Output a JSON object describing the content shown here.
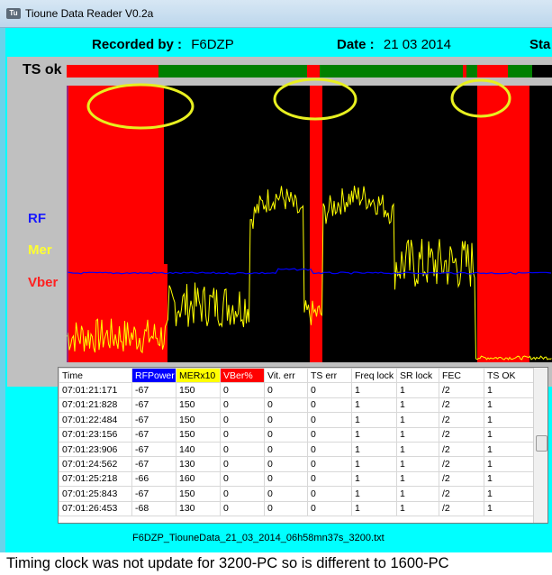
{
  "window": {
    "title": "Tioune Data Reader V0.2a"
  },
  "header": {
    "recorded_label": "Recorded by :",
    "recorded_value": "F6DZP",
    "date_label": "Date :",
    "date_value": "21 03 2014",
    "status_label": "Sta"
  },
  "labels": {
    "tsok": "TS ok",
    "rf": "RF",
    "mer": "Mer",
    "vber": "Vber"
  },
  "colors": {
    "rf": "#0000ff",
    "mer": "#ffff00",
    "vber": "#ff0000",
    "ts_ok": "#008000",
    "background": "#00ffff"
  },
  "table": {
    "headers": [
      "Time",
      "RFPower",
      "MERx10",
      "VBer%",
      "Vit. err",
      "TS err",
      "Freq lock",
      "SR lock",
      "FEC",
      "TS OK"
    ],
    "rows": [
      [
        "07:01:21:171",
        "-67",
        "150",
        "0",
        "0",
        "0",
        "1",
        "1",
        "/2",
        "1"
      ],
      [
        "07:01:21:828",
        "-67",
        "150",
        "0",
        "0",
        "0",
        "1",
        "1",
        "/2",
        "1"
      ],
      [
        "07:01:22:484",
        "-67",
        "150",
        "0",
        "0",
        "0",
        "1",
        "1",
        "/2",
        "1"
      ],
      [
        "07:01:23:156",
        "-67",
        "150",
        "0",
        "0",
        "0",
        "1",
        "1",
        "/2",
        "1"
      ],
      [
        "07:01:23:906",
        "-67",
        "140",
        "0",
        "0",
        "0",
        "1",
        "1",
        "/2",
        "1"
      ],
      [
        "07:01:24:562",
        "-67",
        "130",
        "0",
        "0",
        "0",
        "1",
        "1",
        "/2",
        "1"
      ],
      [
        "07:01:25:218",
        "-66",
        "160",
        "0",
        "0",
        "0",
        "1",
        "1",
        "/2",
        "1"
      ],
      [
        "07:01:25:843",
        "-67",
        "150",
        "0",
        "0",
        "0",
        "1",
        "1",
        "/2",
        "1"
      ],
      [
        "07:01:26:453",
        "-68",
        "130",
        "0",
        "0",
        "0",
        "1",
        "1",
        "/2",
        "1"
      ]
    ]
  },
  "filename": "F6DZP_TiouneData_21_03_2014_06h58mn37s_3200.txt",
  "caption": "Timing clock was not update for 3200-PC so is different to 1600-PC"
}
